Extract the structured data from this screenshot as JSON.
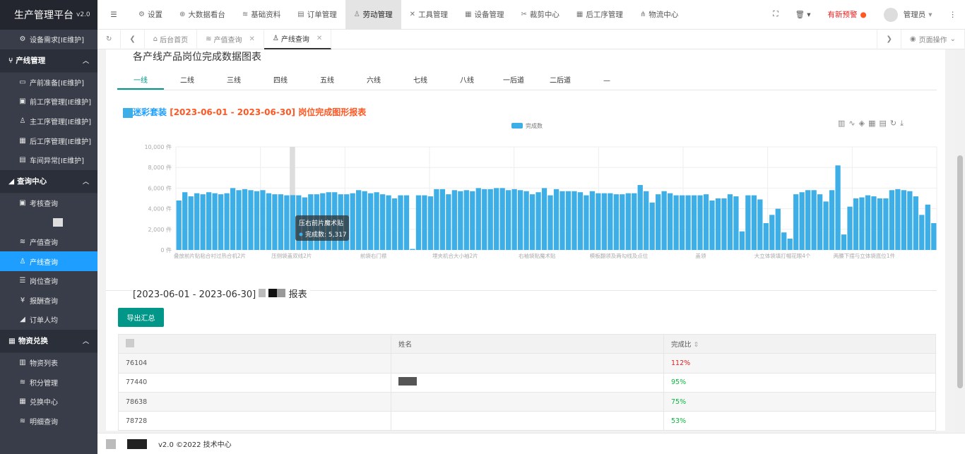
{
  "app": {
    "title": "生产管理平台",
    "version": "v2.0"
  },
  "sidebar": {
    "top_item": {
      "icon": "wrench-icon",
      "label": "设备需求[IE维护]"
    },
    "groups": [
      {
        "label": "产线管理",
        "items": [
          "产前准备[IE维护]",
          "前工序管理[IE维护]",
          "主工序管理[IE维护]",
          "后工序管理[IE维护]",
          "车间异常[IE维护]"
        ]
      },
      {
        "label": "查询中心",
        "items": [
          "考核查询",
          "",
          "产值查询",
          "产线查询",
          "岗位查询",
          "报酬查询",
          "订单人均"
        ]
      },
      {
        "label": "物资兑换",
        "items": [
          "物资列表",
          "积分管理",
          "兑换中心",
          "明细查询"
        ]
      }
    ]
  },
  "topnav": {
    "items": [
      "设置",
      "大数据看台",
      "基础资料",
      "订单管理",
      "劳动管理",
      "工具管理",
      "设备管理",
      "裁剪中心",
      "后工序管理",
      "物流中心"
    ],
    "alert": "有新预警",
    "user": "管理员"
  },
  "tabs": {
    "items": [
      "后台首页",
      "产值查询",
      "产线查询"
    ],
    "page_ops": "页面操作"
  },
  "main": {
    "section_title": "各产线产品岗位完成数据图表",
    "line_tabs": [
      "一线",
      "二线",
      "三线",
      "四线",
      "五线",
      "六线",
      "七线",
      "八线",
      "一后道",
      "二后道",
      "—"
    ],
    "table_title": "[2023-06-01 - 2023-06-30]",
    "table_title_end": "报表",
    "export_label": "导出汇总",
    "table": {
      "headers": [
        "",
        "姓名",
        "完成比"
      ],
      "rows": [
        {
          "id": "76104",
          "name": "",
          "ratio": "112%",
          "color": "#e02020"
        },
        {
          "id": "77440",
          "name": "",
          "ratio": "95%",
          "color": "#09b83e"
        },
        {
          "id": "78638",
          "name": "",
          "ratio": "75%",
          "color": "#09b83e"
        },
        {
          "id": "78728",
          "name": "",
          "ratio": "53%",
          "color": "#09b83e"
        }
      ]
    }
  },
  "footer": {
    "text": "v2.0 ©2022 技术中心"
  },
  "chart_data": {
    "type": "bar",
    "title_prefix": "迷彩套装",
    "title": "[2023-06-01 - 2023-06-30] 岗位完成图形报表",
    "legend": "完成数",
    "ylim": [
      0,
      10000
    ],
    "yticks": [
      "0 件",
      "2,000 件",
      "4,000 件",
      "6,000 件",
      "8,000 件",
      "10,000 件"
    ],
    "xtick_labels": [
      "叠放前片贴粘合衬过热合机2片",
      "压侧袋盖双线2片",
      "前袋右门襟",
      "埋夹机合大小袖2片",
      "右袖袋贴魔术贴",
      "模板翻领及两勾线及点位",
      "盖领",
      "大立体袋填打帽花眼4个",
      "两腰下摆与立体袋底位1件"
    ],
    "tooltip": {
      "label": "压右前片魔术贴",
      "series": "完成数",
      "value": "5,317"
    },
    "color": "#3daee6",
    "values": [
      4800,
      5600,
      5200,
      5500,
      5400,
      5600,
      5500,
      5400,
      5500,
      6000,
      5800,
      5900,
      5800,
      5700,
      5800,
      5500,
      5400,
      5400,
      5300,
      5317,
      5300,
      5100,
      5400,
      5400,
      5500,
      5600,
      5600,
      5400,
      5400,
      5500,
      5800,
      5700,
      5500,
      5600,
      5400,
      5300,
      5000,
      5300,
      5300,
      100,
      5300,
      5300,
      5200,
      5900,
      5900,
      5400,
      5800,
      5700,
      5800,
      5700,
      6000,
      5900,
      5900,
      6000,
      6000,
      5800,
      5900,
      5800,
      5700,
      5400,
      5600,
      6000,
      5300,
      5900,
      5700,
      5700,
      5700,
      5600,
      5300,
      5700,
      5500,
      5500,
      5500,
      5400,
      5400,
      5500,
      5500,
      6300,
      5700,
      4600,
      5400,
      5700,
      5500,
      5300,
      5300,
      5300,
      5300,
      5300,
      5400,
      4800,
      5000,
      5000,
      5400,
      5200,
      1800,
      5300,
      5300,
      4900,
      2600,
      3400,
      4000,
      1700,
      1100,
      5400,
      5600,
      5800,
      5800,
      5400,
      4700,
      5800,
      8200,
      1500,
      4200,
      5000,
      5100,
      5300,
      5200,
      5000,
      5000,
      5800,
      5900,
      5800,
      5700,
      5200,
      3400,
      4400,
      2600
    ]
  }
}
